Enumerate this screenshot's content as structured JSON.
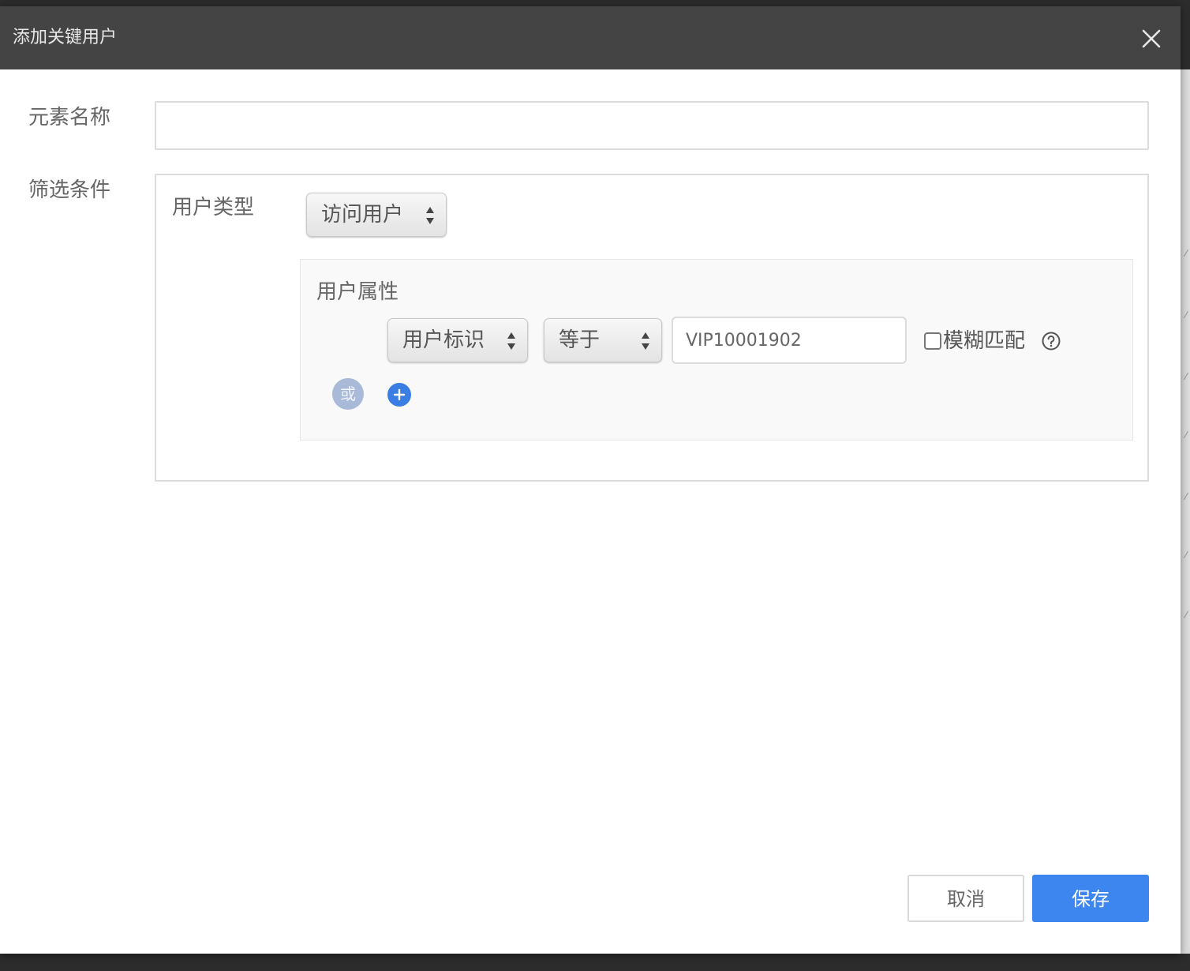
{
  "dialog": {
    "title": "添加关键用户",
    "close_icon": "close-icon"
  },
  "form": {
    "name_label": "元素名称",
    "name_value": "",
    "filter_label": "筛选条件",
    "user_type": {
      "label": "用户类型",
      "selected": "访问用户"
    },
    "user_attributes": {
      "label": "用户属性",
      "field_selected": "用户标识",
      "operator_selected": "等于",
      "value": "VIP10001902",
      "fuzzy_label": "模糊匹配",
      "fuzzy_checked": false,
      "help_icon": "question-circle-icon",
      "or_label": "或",
      "add_icon": "plus-circle-icon"
    }
  },
  "footer": {
    "cancel_label": "取消",
    "save_label": "保存"
  },
  "colors": {
    "header_bg": "#444444",
    "primary": "#3d86f0",
    "or_badge": "#a9b9d8"
  }
}
